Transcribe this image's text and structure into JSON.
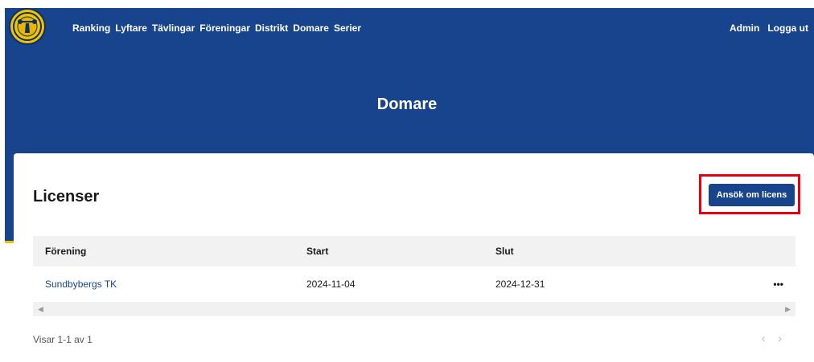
{
  "nav": {
    "items": [
      "Ranking",
      "Lyftare",
      "Tävlingar",
      "Föreningar",
      "Distrikt",
      "Domare",
      "Serier"
    ],
    "right": [
      "Admin",
      "Logga ut"
    ]
  },
  "page": {
    "title": "Domare"
  },
  "card": {
    "title": "Licenser",
    "apply_button": "Ansök om licens"
  },
  "table": {
    "headers": [
      "Förening",
      "Start",
      "Slut"
    ],
    "rows": [
      {
        "club": "Sundbybergs TK",
        "start": "2024-11-04",
        "end": "2024-12-31",
        "actions": "•••"
      }
    ]
  },
  "footer": {
    "summary": "Visar 1-1 av 1",
    "prev": "‹",
    "next": "›"
  },
  "colors": {
    "brand_blue": "#17448c",
    "accent_yellow": "#f2c400",
    "highlight_red": "#e8000f"
  }
}
